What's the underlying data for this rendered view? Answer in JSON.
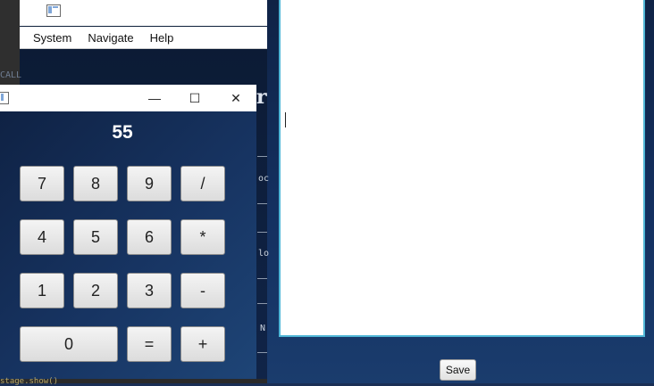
{
  "back_window": {
    "menu": [
      "System",
      "Navigate",
      "Help"
    ],
    "call_text": "CALL",
    "code_fragments": [
      "oc",
      "lo",
      "N"
    ],
    "big_glyph": "r",
    "glyph_dots": "' '",
    "bottom_code": "stage.show()"
  },
  "calculator": {
    "display_value": "55",
    "window_controls": {
      "minimize": "—",
      "maximize": "☐",
      "close": "✕"
    },
    "keys": [
      "7",
      "8",
      "9",
      "/",
      "4",
      "5",
      "6",
      "*",
      "1",
      "2",
      "3",
      "-",
      "0",
      "=",
      "+"
    ]
  },
  "editor": {
    "content": "",
    "save_label": "Save"
  },
  "colors": {
    "editor_border": "#4fb6d6",
    "background": "#143060"
  }
}
